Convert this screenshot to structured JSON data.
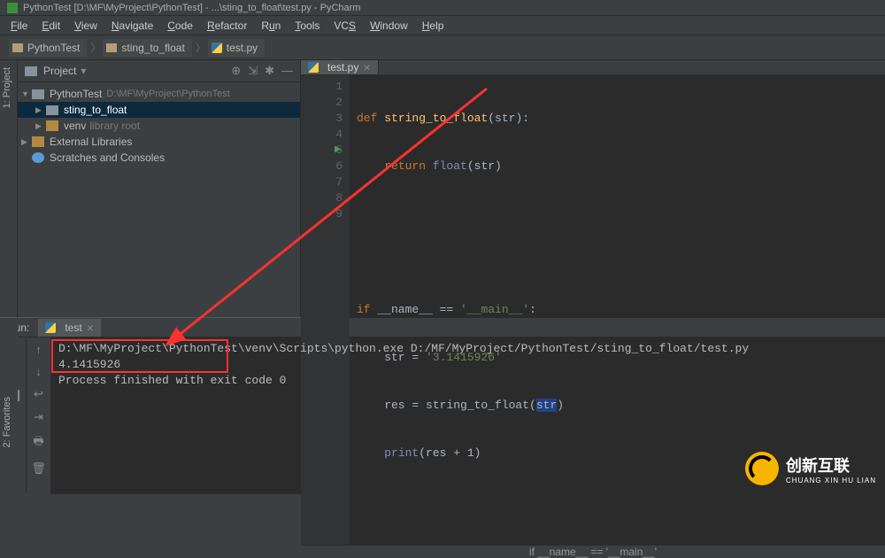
{
  "title": "PythonTest [D:\\MF\\MyProject\\PythonTest] - ...\\sting_to_float\\test.py - PyCharm",
  "menu": [
    "File",
    "Edit",
    "View",
    "Navigate",
    "Code",
    "Refactor",
    "Run",
    "Tools",
    "VCS",
    "Window",
    "Help"
  ],
  "menu_u": [
    "F",
    "E",
    "V",
    "N",
    "C",
    "R",
    "u",
    "T",
    "S",
    "W",
    "H"
  ],
  "breadcrumb": {
    "a": "PythonTest",
    "b": "sting_to_float",
    "c": "test.py"
  },
  "left_tool": "1: Project",
  "left_tool2": "2: Favorites",
  "project": {
    "header": "Project",
    "root": "PythonTest",
    "root_path": "D:\\MF\\MyProject\\PythonTest",
    "folder1": "sting_to_float",
    "folder2": "venv",
    "folder2_suffix": "library root",
    "ext_lib": "External Libraries",
    "scratch": "Scratches and Consoles"
  },
  "editor": {
    "tab": "test.py",
    "hint": "if __name__ == '__main__'",
    "code": {
      "l1": {
        "a": "def ",
        "b": "string_to_float",
        "c": "(str):"
      },
      "l2": {
        "a": "    ",
        "b": "return ",
        "c": "float",
        "d": "(str)"
      },
      "l3": "",
      "l4": "",
      "l5": {
        "a": "if ",
        "b": "__name__",
        "c": " == ",
        "d": "'__main__'",
        "e": ":"
      },
      "l6": {
        "a": "    str = ",
        "b": "'3.1415926'"
      },
      "l7": {
        "a": "    res = ",
        "b": "string_to_float",
        "c": "(",
        "d": "str",
        "e": ")"
      },
      "l8": {
        "a": "    ",
        "b": "print",
        "c": "(res + ",
        "d": "1",
        "e": ")"
      },
      "l9": ""
    },
    "nums": [
      "1",
      "2",
      "3",
      "4",
      "5",
      "6",
      "7",
      "8",
      "9"
    ]
  },
  "run": {
    "label": "Run:",
    "tab": "test",
    "out1": "D:\\MF\\MyProject\\PythonTest\\venv\\Scripts\\python.exe D:/MF/MyProject/PythonTest/sting_to_float/test.py",
    "out2": "4.1415926",
    "out3": "",
    "out4": "Process finished with exit code 0"
  },
  "watermark": {
    "main": "创新互联",
    "sub": "CHUANG XIN HU LIAN"
  }
}
